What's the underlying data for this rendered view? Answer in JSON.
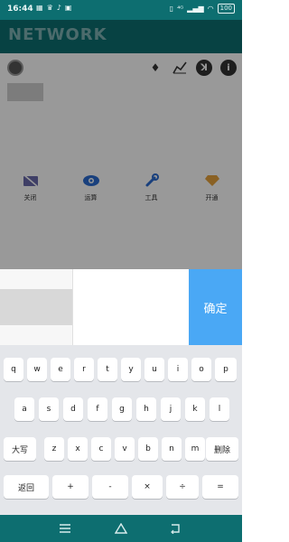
{
  "status_bar": {
    "time": "16:44",
    "left_icons": [
      "notification-icon",
      "crown-icon",
      "tiktok-icon",
      "app-icon"
    ],
    "right_icons": [
      "nfc-icon",
      "signal-4g-icon",
      "signal-bars-icon",
      "wifi-icon"
    ],
    "battery": "100"
  },
  "header": {
    "logo": "NETWORK"
  },
  "profile": {
    "top_icons": [
      "vip-diamond-icon",
      "chart-line-icon",
      "tool-icon",
      "info-icon"
    ]
  },
  "features": [
    {
      "icon": "camera-off-icon",
      "label": "关闭",
      "color": "#6a6aaa"
    },
    {
      "icon": "eye-icon",
      "label": "运算",
      "color": "#2b6cd1"
    },
    {
      "icon": "wrench-icon",
      "label": "工具",
      "color": "#2b6cd1"
    },
    {
      "icon": "diamond-icon",
      "label": "开通",
      "color": "#e6a23c"
    }
  ],
  "input_row": {
    "confirm_label": "确定",
    "confirm_color": "#4aa8f5"
  },
  "keyboard": {
    "row1": [
      "q",
      "w",
      "e",
      "r",
      "t",
      "y",
      "u",
      "i",
      "o",
      "p"
    ],
    "row2": [
      "a",
      "s",
      "d",
      "f",
      "g",
      "h",
      "j",
      "k",
      "l"
    ],
    "row3": [
      "大写",
      "z",
      "x",
      "c",
      "v",
      "b",
      "n",
      "m",
      "删除"
    ],
    "row4": [
      "返回",
      "+",
      "-",
      "×",
      "÷",
      "="
    ]
  },
  "nav_bar": {
    "icons": [
      "menu-icon",
      "home-icon",
      "back-icon"
    ]
  },
  "colors": {
    "primary": "#0d6e70",
    "accent": "#4aa8f5",
    "keyboard_bg": "#e4e6ea"
  }
}
